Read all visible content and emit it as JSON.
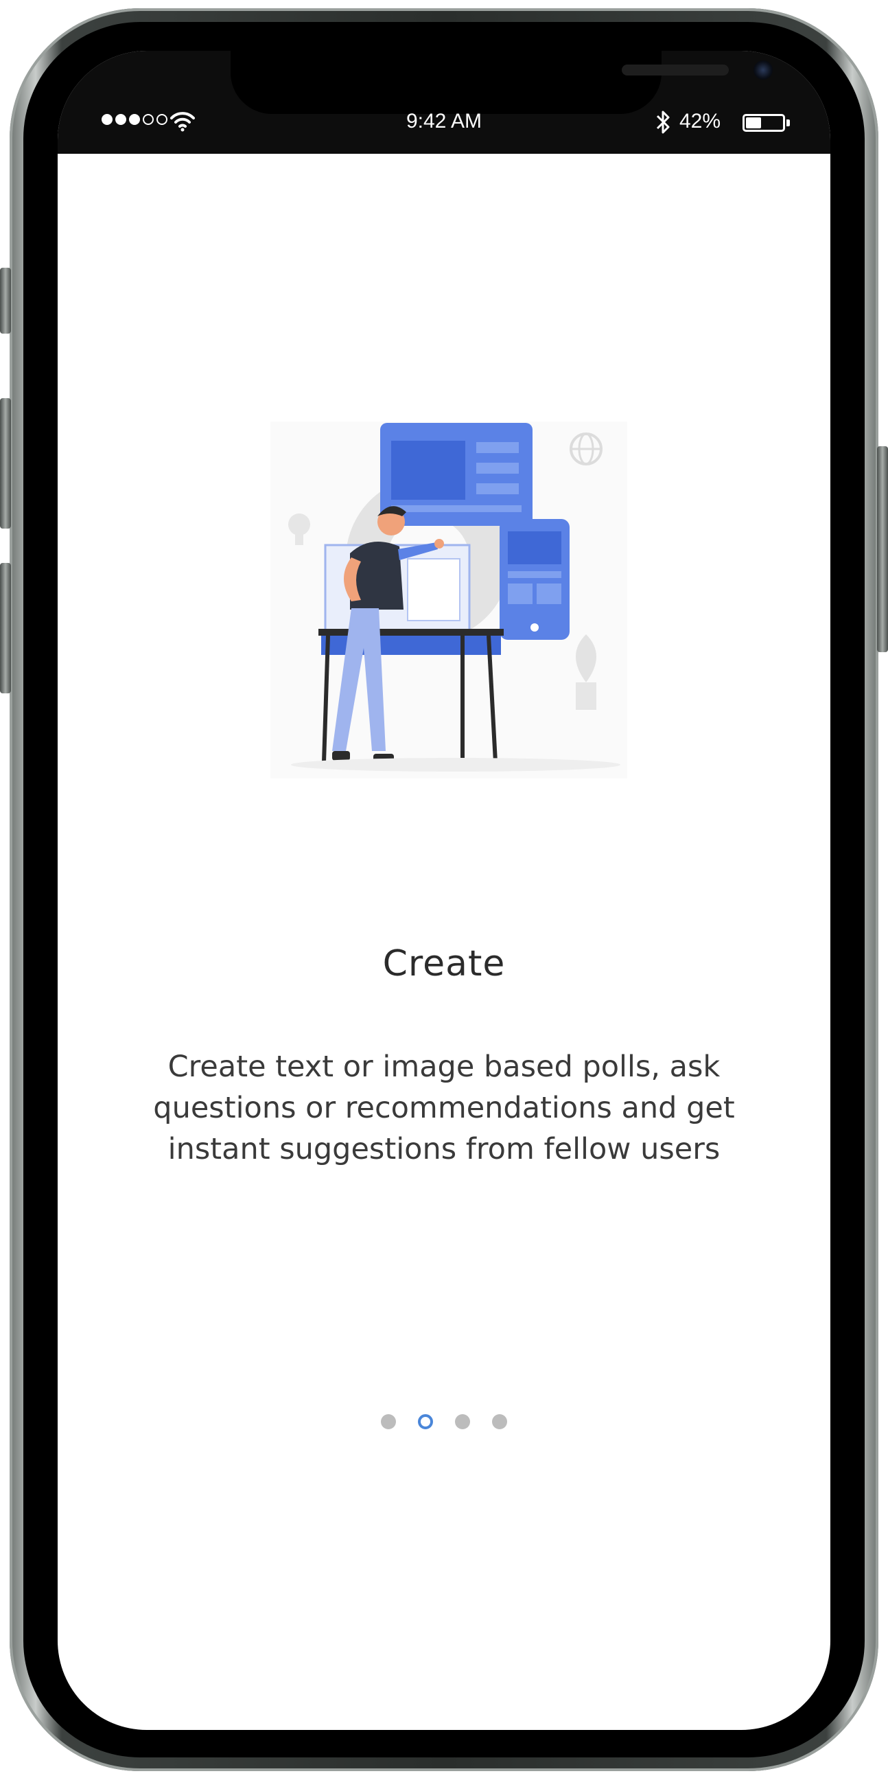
{
  "status_bar": {
    "time": "9:42 AM",
    "battery_percent": "42%",
    "battery_level": 0.42,
    "signal_bars_filled": 3,
    "signal_bars_total": 5,
    "icons": [
      "signal-dots-icon",
      "wifi-icon",
      "bluetooth-icon",
      "battery-icon"
    ]
  },
  "onboarding": {
    "title": "Create",
    "description": "Create text or image based polls, ask questions or recommendations and get instant suggestions from fellow users",
    "pages_total": 4,
    "active_page": 2
  },
  "colors": {
    "accent": "#4a86d9",
    "illustration_blue": "#5b82e6",
    "dot_inactive": "#bcbcbc",
    "status_bar_bg": "#0d0d0d",
    "text_primary": "#2b2b2b"
  }
}
